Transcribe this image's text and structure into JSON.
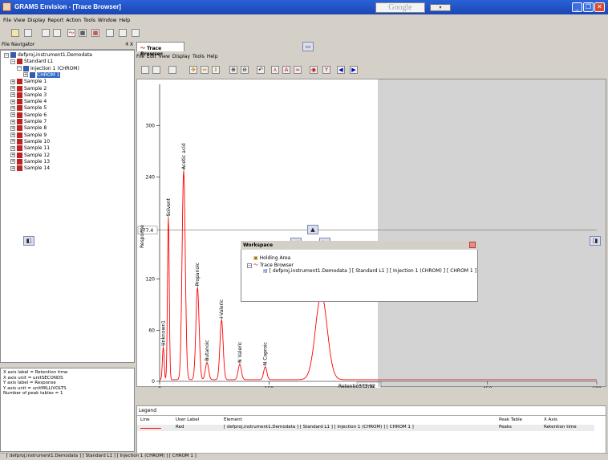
{
  "app": {
    "title": "GRAMS Envision - [Trace Browser]"
  },
  "google": {
    "logo": "Google",
    "btn": "▾"
  },
  "menubar": [
    "File",
    "View",
    "Display",
    "Report",
    "Action",
    "Tools",
    "Window",
    "Help"
  ],
  "nav": {
    "header": "File Navigator",
    "pin": "₰ X",
    "tree": [
      {
        "label": "defproj,instrument1.Demodata",
        "level": 0,
        "exp": "−"
      },
      {
        "label": "Standard L1",
        "level": 1,
        "exp": "−"
      },
      {
        "label": "Injection 1 (CHROM)",
        "level": 2,
        "exp": "−"
      },
      {
        "label": "CHROM 1",
        "level": 3,
        "exp": "+",
        "selected": true
      },
      {
        "label": "Sample 1",
        "level": 1,
        "exp": "+"
      },
      {
        "label": "Sample 2",
        "level": 1,
        "exp": "+"
      },
      {
        "label": "Sample 3",
        "level": 1,
        "exp": "+"
      },
      {
        "label": "Sample 4",
        "level": 1,
        "exp": "+"
      },
      {
        "label": "Sample 5",
        "level": 1,
        "exp": "+"
      },
      {
        "label": "Sample 6",
        "level": 1,
        "exp": "+"
      },
      {
        "label": "Sample 7",
        "level": 1,
        "exp": "+"
      },
      {
        "label": "Sample 8",
        "level": 1,
        "exp": "+"
      },
      {
        "label": "Sample 9",
        "level": 1,
        "exp": "+"
      },
      {
        "label": "Sample 10",
        "level": 1,
        "exp": "+"
      },
      {
        "label": "Sample 11",
        "level": 1,
        "exp": "+"
      },
      {
        "label": "Sample 12",
        "level": 1,
        "exp": "+"
      },
      {
        "label": "Sample 13",
        "level": 1,
        "exp": "+"
      },
      {
        "label": "Sample 14",
        "level": 1,
        "exp": "+"
      }
    ]
  },
  "info": [
    "X axis label = Retention time",
    "X axis unit = unitSECONDS",
    "Y axis label = Response",
    "Y axis unit = unitMILLIVOLTS",
    "Number of peak tables = 1"
  ],
  "trace_tab": "Trace Browser",
  "submenu": [
    "File",
    "Edit",
    "View",
    "Display",
    "Tools",
    "Help"
  ],
  "cursor_value": "177.4",
  "cursor_x_value": "303.92",
  "xlabel": "Retention time",
  "ylabel": "Response",
  "chart_data": {
    "type": "line",
    "xlabel": "Retention time",
    "ylabel": "Response",
    "xlim": [
      0,
      600
    ],
    "ylim": [
      0,
      360
    ],
    "xticks": [
      "0",
      "150",
      "450",
      "600"
    ],
    "yticks": [
      "0",
      "60",
      "120",
      "240",
      "300"
    ],
    "peaks": [
      {
        "name": "Unknown1",
        "x": 5,
        "y": 38
      },
      {
        "name": "Solvent",
        "x": 12,
        "y": 190
      },
      {
        "name": "Acetic acid",
        "x": 33,
        "y": 245
      },
      {
        "name": "Propanoic",
        "x": 52,
        "y": 108
      },
      {
        "name": "Butanoic",
        "x": 65,
        "y": 20
      },
      {
        "name": "I Valeric",
        "x": 85,
        "y": 70
      },
      {
        "name": "N Valeric",
        "x": 110,
        "y": 18
      },
      {
        "name": "N Caproic",
        "x": 145,
        "y": 15
      },
      {
        "name": "",
        "x": 222,
        "y": 100
      }
    ]
  },
  "workspace": {
    "title": "Workspace",
    "holding": "Holding Area",
    "trace": "Trace Browser",
    "item": "[ defproj,instrument1.Demodata ] [ Standard L1 ] [ Injection 1 (CHROM) ] [ CHROM 1 ]"
  },
  "legend": {
    "title": "Legend",
    "headers": [
      "Line",
      "User Label",
      "Element",
      "Peak Table",
      "X Axis"
    ],
    "row": {
      "label": "Red",
      "element": "[ defproj,instrument1.Demodata ] [ Standard L1 ] [ Injection 1 (CHROM) ] [ CHROM 1 ]",
      "peak_table": "Peaks",
      "x_axis": "Retention time"
    }
  },
  "status": "[ defproj,instrument1.Demodata ] [ Standard L1 ] [ Injection 1 (CHROM) ] [ CHROM 1 ]",
  "colors": {
    "trace": "#ff0000",
    "titlebar": "#2a62d8"
  }
}
